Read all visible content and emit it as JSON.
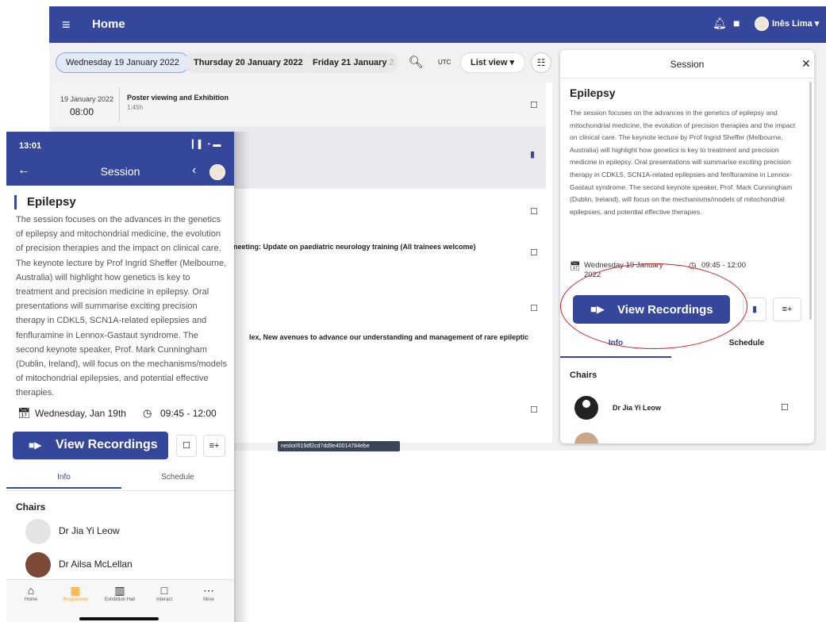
{
  "desktop": {
    "topbar": {
      "title": "Home",
      "menu_icon": "≡",
      "user": "Inês Lima ▾"
    },
    "dates": {
      "d1": "Wednesday 19 January 2022",
      "d2": "Thursday 20 January 2022",
      "d3": "Friday 21 January",
      "d3_fade": "2"
    },
    "utc": "UTC",
    "list_view": "List view  ▾",
    "list": {
      "row1": {
        "date": "19 January 2022",
        "time": "08:00",
        "title": "Poster viewing and Exhibition",
        "duration": "1:45h"
      },
      "frag1": "neeting: Update on paediatric neurology training (All trainees welcome)",
      "frag2": "lex, New avenues to advance our understanding and management of rare epileptic"
    },
    "url_tooltip": "neslot/619df2cd7dd9e40014784ebe",
    "panel": {
      "header": "Session",
      "close": "✕",
      "title": "Epilepsy",
      "description": "The session focuses on the advances in the genetics of epilepsy and mitochondrial medicine, the evolution of precision therapies and the impact on clinical care. The keynote lecture by Prof Ingrid Sheffer (Melbourne, Australia) will highlight how genetics is key to treatment and precision medicine in epilepsy. Oral presentations will summarise exciting precision therapy in CDKL5, SCN1A-related epilepsies and fenfluramine in Lennox-Gastaut syndrome. The second keynote speaker, Prof. Mark Cunningham (Dublin, Ireland), will focus on the mechanisms/models of mitochondrial epilepsies, and potential effective therapies.",
      "date": "Wednesday 19 January 2022",
      "time": "09:45 - 12:00",
      "view_recordings": "View Recordings",
      "tab_info": "Info",
      "tab_schedule": "Schedule",
      "chairs_label": "Chairs",
      "chair1": "Dr Jia Yi Leow"
    }
  },
  "phone": {
    "status_time": "13:01",
    "nav_title": "Session",
    "title": "Epilepsy",
    "description": "The session focuses on the advances in the genetics of epilepsy and mitochondrial medicine, the evolution of precision therapies and the impact on clinical care. The keynote lecture by Prof Ingrid Sheffer (Melbourne, Australia) will highlight how genetics is key to treatment and precision medicine in epilepsy. Oral presentations will summarise exciting precision therapy in CDKL5, SCN1A-related epilepsies and fenfluramine in Lennox-Gastaut syndrome. The second keynote speaker, Prof. Mark Cunningham (Dublin, Ireland), will focus on the mechanisms/models of mitochondrial epilepsies, and potential effective therapies.",
    "date": "Wednesday, Jan 19th",
    "time": "09:45 - 12:00",
    "view_recordings": "View Recordings",
    "tab_info": "Info",
    "tab_schedule": "Schedule",
    "chairs_label": "Chairs",
    "chair1": "Dr Jia Yi Leow",
    "chair2": "Dr Ailsa McLellan",
    "tabbar": {
      "home": "Home",
      "programme": "Programme",
      "exhibition": "Exhibition Hall",
      "interact": "Interact",
      "more": "More"
    }
  },
  "colors": {
    "brand": "#35479a",
    "accent": "#f2a02a",
    "annotation": "#d21d1d"
  },
  "icons": [
    "menu-icon",
    "bell-icon",
    "chat-icon",
    "search-icon",
    "filter-icon",
    "bookmark-icon",
    "close-icon",
    "calendar-icon",
    "clock-icon",
    "video-icon",
    "queue-add-icon",
    "back-arrow-icon",
    "share-icon",
    "home-icon",
    "programme-icon",
    "exhibition-icon",
    "interact-icon",
    "more-icon"
  ]
}
